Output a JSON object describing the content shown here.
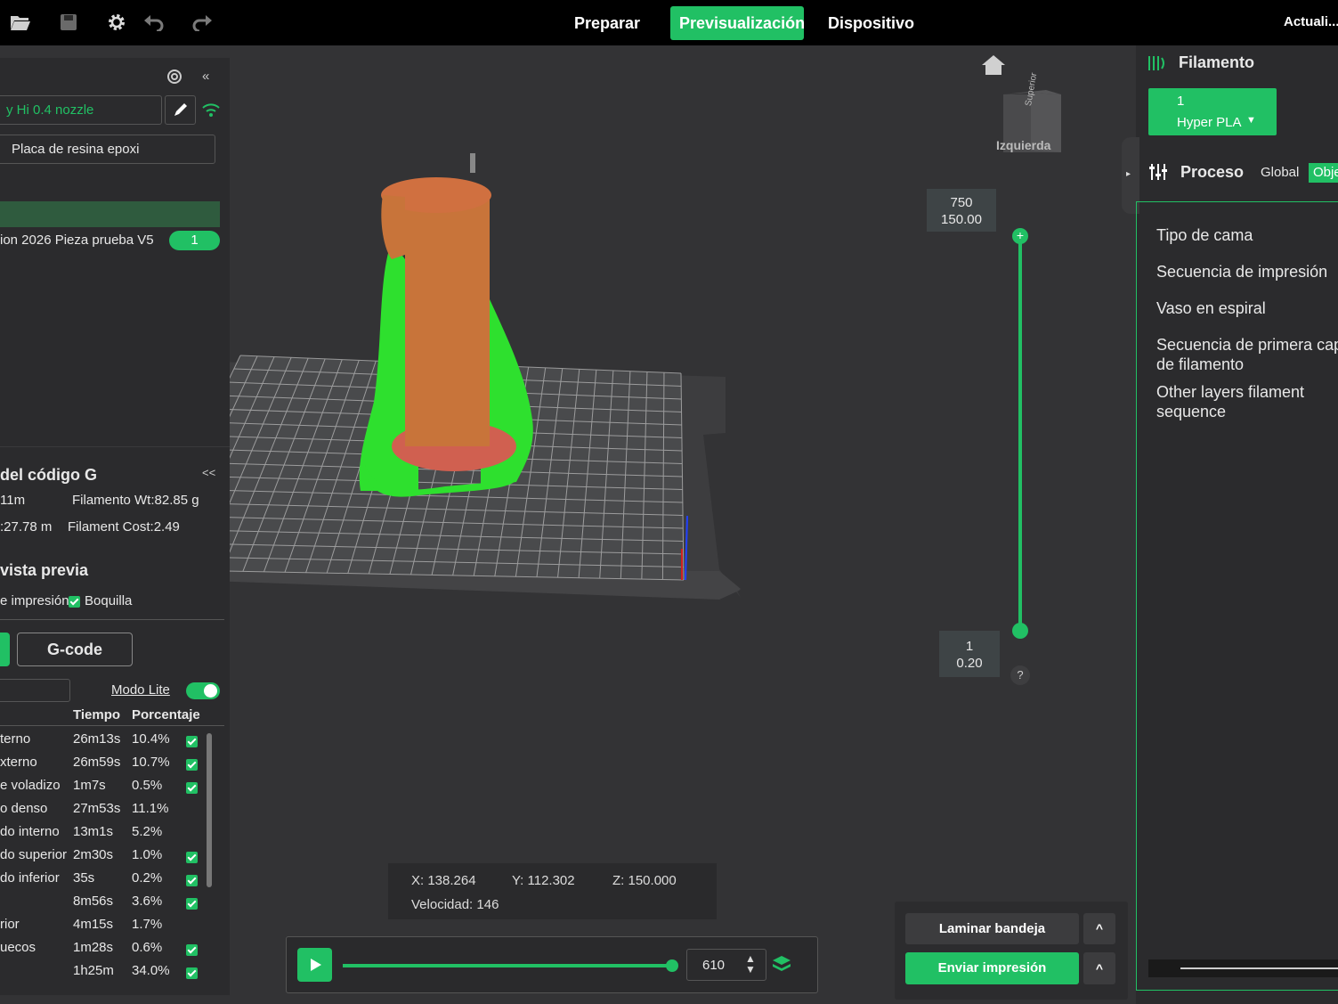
{
  "topbar": {
    "tabs": [
      "Preparar",
      "Previsualización",
      "Dispositivo"
    ],
    "right_label": "Actuali..."
  },
  "left": {
    "printer_name": "y Hi 0.4 nozzle",
    "plate_type": "Placa de resina epoxi",
    "object_name": "ion 2026 Pieza prueba V5",
    "object_count": "1",
    "gcode_title": "del código G",
    "stat_time": "11m",
    "stat_weight": "Filamento Wt:82.85 g",
    "stat_length": ":27.78 m",
    "stat_cost": "Filament Cost:2.49",
    "preview_title": "vista previa",
    "opt_print": "e impresión",
    "opt_nozzle": "Boquilla",
    "gcode_button": "G-code",
    "lite_mode": "Modo Lite",
    "col_time": "Tiempo",
    "col_pct": "Porcentaje",
    "rows": [
      {
        "name": "terno",
        "time": "26m13s",
        "pct": "10.4%",
        "checked": true
      },
      {
        "name": "xterno",
        "time": "26m59s",
        "pct": "10.7%",
        "checked": true
      },
      {
        "name": "e voladizo",
        "time": "1m7s",
        "pct": "0.5%",
        "checked": true
      },
      {
        "name": "o denso",
        "time": "27m53s",
        "pct": "11.1%",
        "checked": false
      },
      {
        "name": "do interno",
        "time": "13m1s",
        "pct": "5.2%",
        "checked": false
      },
      {
        "name": "do superior",
        "time": "2m30s",
        "pct": "1.0%",
        "checked": true
      },
      {
        "name": "do inferior",
        "time": "35s",
        "pct": "0.2%",
        "checked": true
      },
      {
        "name": "",
        "time": "8m56s",
        "pct": "3.6%",
        "checked": true
      },
      {
        "name": "rior",
        "time": "4m15s",
        "pct": "1.7%",
        "checked": false
      },
      {
        "name": "uecos",
        "time": "1m28s",
        "pct": "0.6%",
        "checked": true
      },
      {
        "name": "",
        "time": "1h25m",
        "pct": "34.0%",
        "checked": true
      }
    ]
  },
  "viewport": {
    "cube_top": "Superior",
    "cube_left": "Izquierda",
    "slider_top_layer": "750",
    "slider_top_height": "150.00",
    "slider_bottom_layer": "1",
    "slider_bottom_height": "0.20",
    "help": "?",
    "pos_x": "X: 138.264",
    "pos_y": "Y: 112.302",
    "pos_z": "Z: 150.000",
    "speed": "Velocidad: 146",
    "playback_value": "610",
    "slice_button": "Laminar bandeja",
    "send_button": "Enviar impresión",
    "caret": "^"
  },
  "right": {
    "filament_title": "Filamento",
    "filament_index": "1",
    "filament_type": "Hyper PLA",
    "process_title": "Proceso",
    "process_global": "Global",
    "process_object": "Objeto",
    "items": [
      "Tipo de cama",
      "Secuencia de impresión",
      "Vaso en espiral",
      "Secuencia de primera capa de filamento",
      "Other layers filament sequence"
    ]
  },
  "colors": {
    "accent": "#21c064",
    "object_orange": "#c8743a",
    "support_green": "#2ee02e"
  }
}
